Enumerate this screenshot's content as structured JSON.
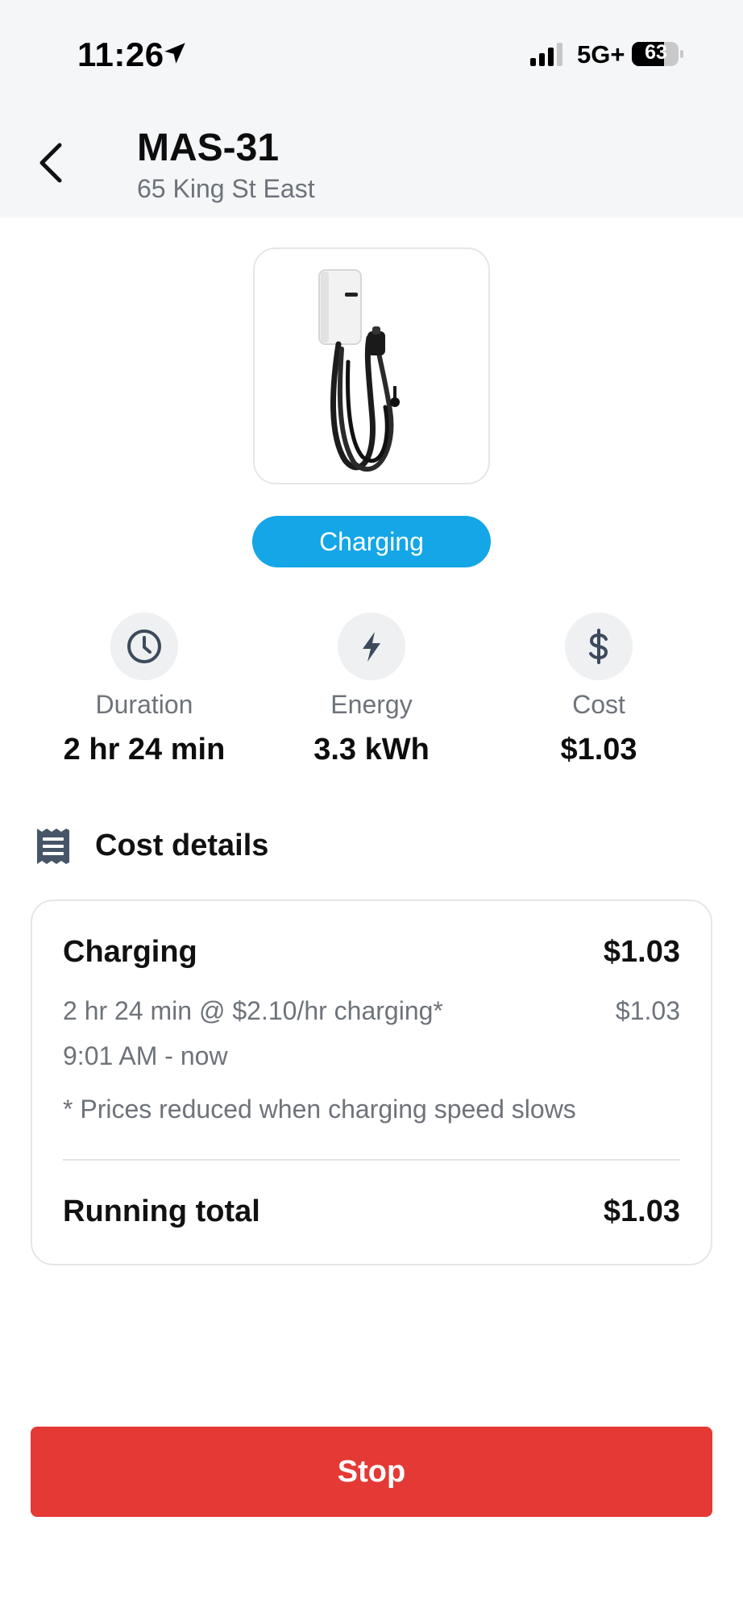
{
  "status_bar": {
    "time": "11:26",
    "network": "5G+",
    "battery": "63"
  },
  "header": {
    "station_name": "MAS-31",
    "address": "65 King St East"
  },
  "status": {
    "label": "Charging",
    "color": "#14a6e6"
  },
  "stats": [
    {
      "icon": "clock-icon",
      "label": "Duration",
      "value": "2 hr 24 min"
    },
    {
      "icon": "lightning-icon",
      "label": "Energy",
      "value": "3.3 kWh"
    },
    {
      "icon": "dollar-icon",
      "label": "Cost",
      "value": "$1.03"
    }
  ],
  "cost_details": {
    "title": "Cost details",
    "section_label": "Charging",
    "section_amount": "$1.03",
    "line_desc": "2 hr 24 min @ $2.10/hr charging*",
    "line_amount": "$1.03",
    "time_range": "9:01 AM - now",
    "footnote": "* Prices reduced when charging speed slows",
    "total_label": "Running total",
    "total_amount": "$1.03"
  },
  "actions": {
    "stop_label": "Stop",
    "stop_color": "#e53935"
  }
}
